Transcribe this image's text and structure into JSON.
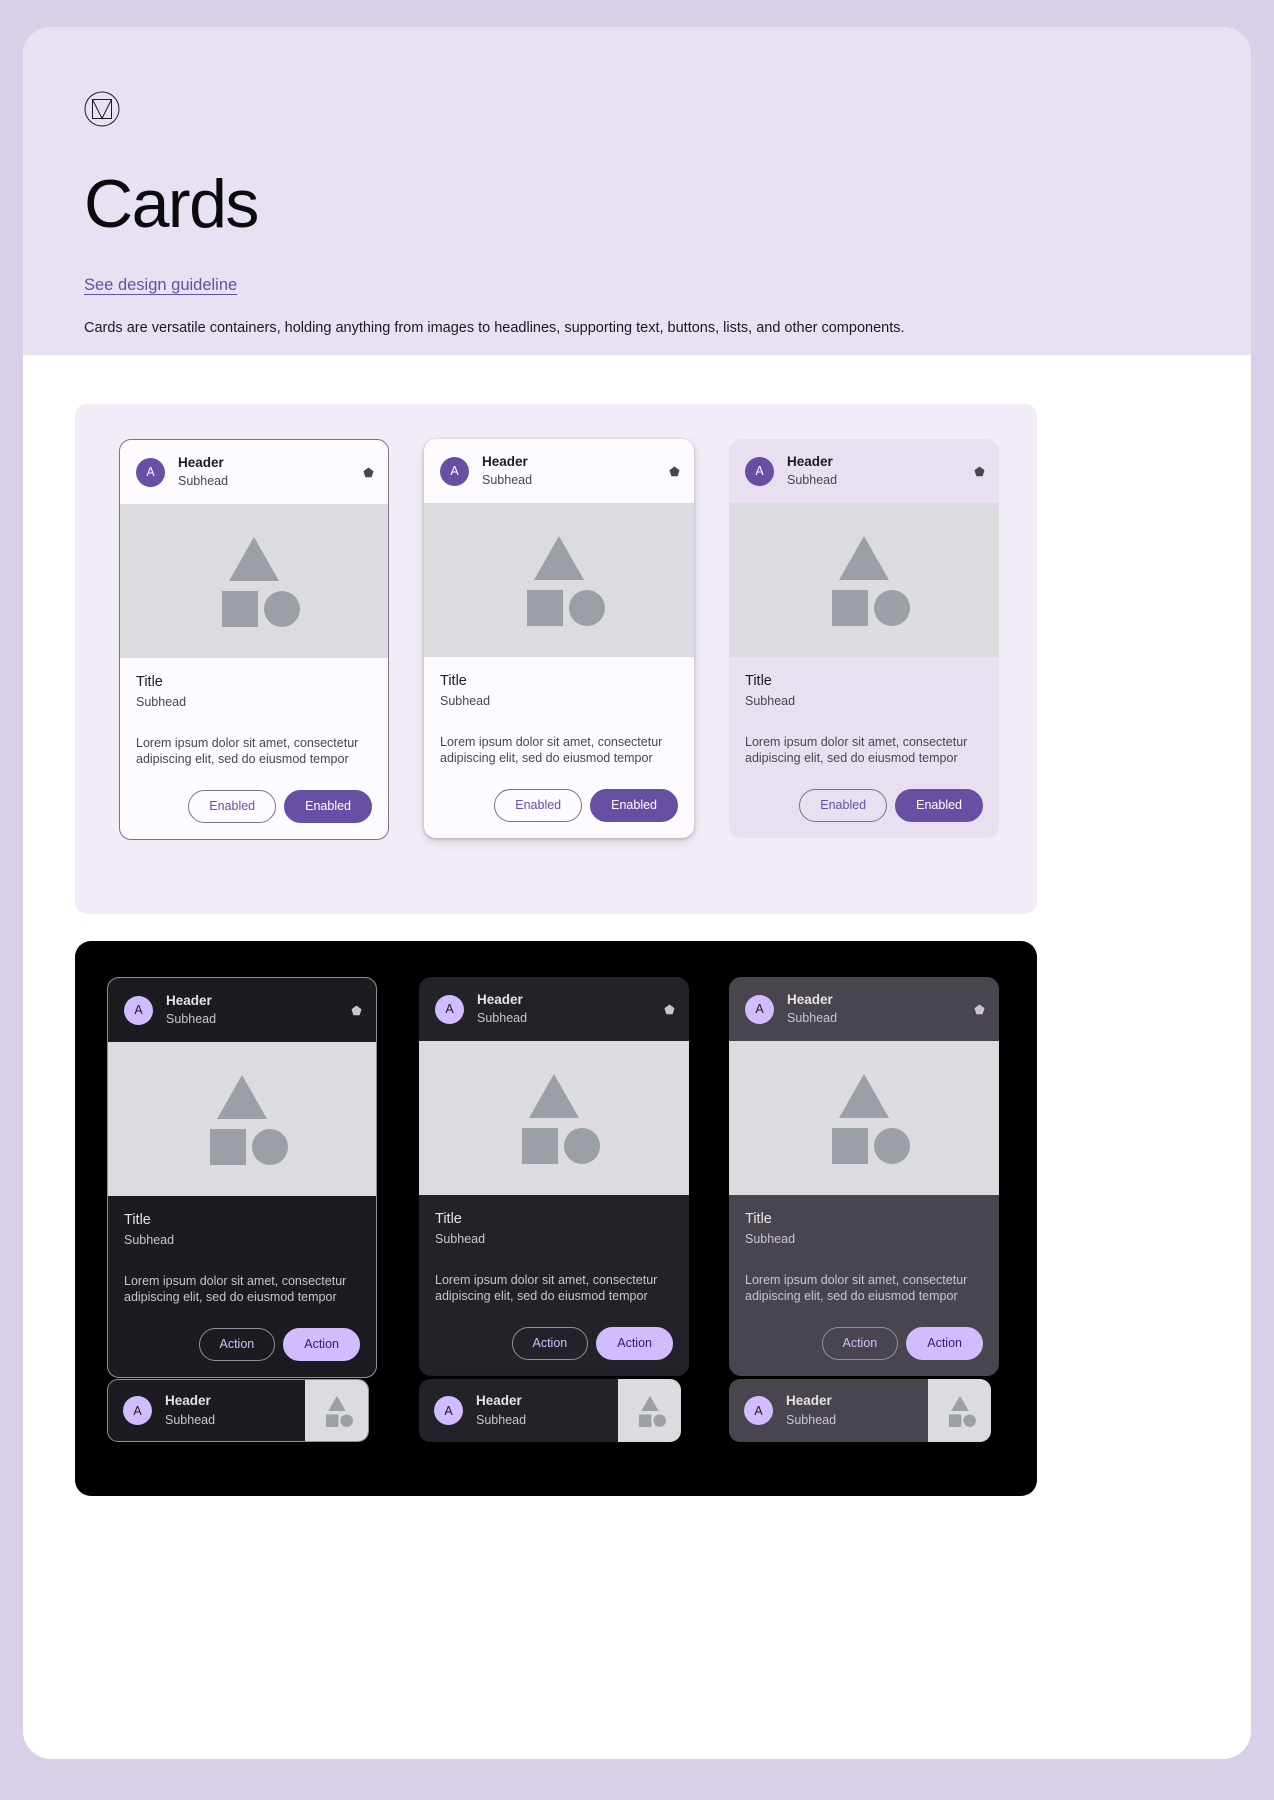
{
  "hero": {
    "logo_icon": "material-logo-icon",
    "title": "Cards",
    "link": "See design guideline",
    "description": "Cards are versatile containers, holding anything from images to headlines, supporting text, buttons, lists, and other components."
  },
  "card": {
    "avatar_letter": "A",
    "header": "Header",
    "subhead": "Subhead",
    "title": "Title",
    "body_subhead": "Subhead",
    "body_text": "Lorem ipsum dolor sit amet, consectetur adipiscing elit, sed do eiusmod tempor",
    "menu_icon": "pentagon-icon",
    "media_icon": "media-placeholder-icon"
  },
  "buttons": {
    "light_outline": "Enabled",
    "light_fill": "Enabled",
    "dark_outline": "Action",
    "dark_fill": "Action"
  },
  "variants": {
    "light": [
      "outlined",
      "elevated",
      "filled"
    ],
    "dark": [
      "dark-outlined",
      "dark-elevated",
      "dark-filled"
    ]
  },
  "colors": {
    "page_bg": "#d9cfe8",
    "hero_bg": "#e8e1f1",
    "light_panel_bg": "#f1ecf7",
    "dark_panel_bg": "#000000",
    "accent": "#6750a4",
    "dark_accent": "#d0bcff",
    "media_bg": "#dcdce0",
    "filled_card_bg": "#e8e0ee",
    "dark_filled_card_bg": "#48454e"
  }
}
